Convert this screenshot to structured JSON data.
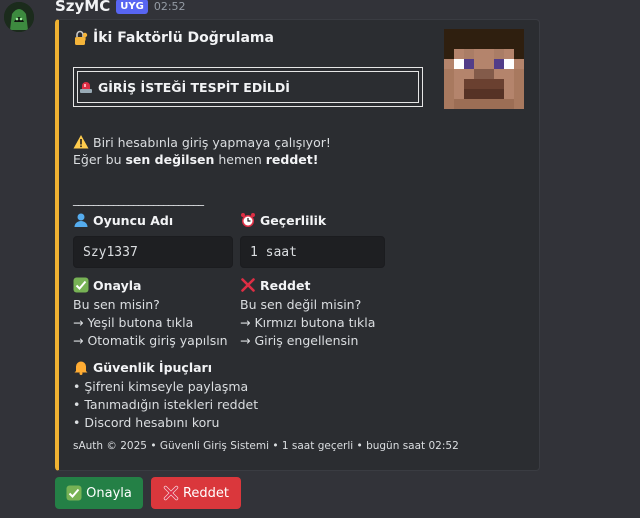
{
  "message": {
    "username": "SzyMC",
    "app_badge": "UYG",
    "timestamp": "02:52"
  },
  "embed": {
    "accent_color": "#f0b232",
    "title": "İki Faktörlü Doğrulama",
    "alert": "GİRİŞ İSTEĞİ TESPİT EDİLDİ",
    "warning_line": "Biri hesabınla giriş yapmaya çalışıyor!",
    "line2_pre": "Eğer bu ",
    "line2_bold": "sen değilsen",
    "line2_mid": " hemen ",
    "line2_bold2": "reddet!",
    "divider": "__________________________",
    "fields": {
      "player": {
        "name": "Oyuncu Adı",
        "value": "Szy1337"
      },
      "validity": {
        "name": "Geçerlilik",
        "value": "1 saat"
      },
      "approve": {
        "name": "Onayla",
        "lines": [
          "Bu sen misin?",
          "→ Yeşil butona tıkla",
          "→ Otomatik giriş yapılsın"
        ]
      },
      "reject": {
        "name": "Reddet",
        "lines": [
          "Bu sen değil misin?",
          "→ Kırmızı butona tıkla",
          "→ Giriş engellensin"
        ]
      },
      "tips": {
        "name": "Güvenlik İpuçları",
        "lines": [
          "• Şifreni kimseyle paylaşma",
          "• Tanımadığın istekleri reddet",
          "• Discord hesabını koru"
        ]
      }
    },
    "footer": "sAuth © 2025 • Güvenli Giriş Sistemi • 1 saat geçerli  • bugün saat 02:52"
  },
  "buttons": {
    "approve": {
      "label": "Onayla",
      "color": "#248046"
    },
    "reject": {
      "label": "Reddet",
      "color": "#da373c"
    }
  }
}
